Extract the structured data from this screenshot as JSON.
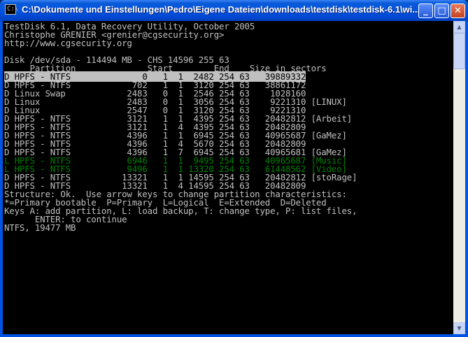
{
  "window": {
    "title": "C:\\Dokumente und Einstellungen\\Pedro\\Eigene Dateien\\downloads\\testdisk\\testdisk-6.1\\wi...",
    "icon": "console-icon",
    "icon_glyph": "C:\\",
    "buttons": {
      "minimize": "_",
      "maximize": "□",
      "close": "✕"
    }
  },
  "console": {
    "header": [
      "TestDisk 6.1, Data Recovery Utility, October 2005",
      "Christophe GRENIER <grenier@cgsecurity.org>",
      "http://www.cgsecurity.org"
    ],
    "disk_line": "Disk /dev/sda - 114494 MB - CHS 14596 255 63",
    "columns_line": "     Partition              Start        End    Size in sectors",
    "partitions": [
      {
        "text": "D HPFS - NTFS              0   1  1  2482 254 63   39889332",
        "selected": true,
        "color": "#c0c0c0"
      },
      {
        "text": "D HPFS - NTFS            702   1  1  3120 254 63   38861172",
        "color": "#c0c0c0"
      },
      {
        "text": "D Linux Swap            2483   0  1  2546 254 63    1028160",
        "color": "#c0c0c0"
      },
      {
        "text": "D Linux                 2483   0  1  3056 254 63    9221310 [LINUX]",
        "color": "#c0c0c0"
      },
      {
        "text": "D Linux                 2547   0  1  3120 254 63    9221310",
        "color": "#c0c0c0"
      },
      {
        "text": "D HPFS - NTFS           3121   1  1  4395 254 63   20482812 [Arbeit]",
        "color": "#c0c0c0"
      },
      {
        "text": "D HPFS - NTFS           3121   1  4  4395 254 63   20482809",
        "color": "#c0c0c0"
      },
      {
        "text": "D HPFS - NTFS           4396   1  1  6945 254 63   40965687 [GaMez]",
        "color": "#c0c0c0"
      },
      {
        "text": "D HPFS - NTFS           4396   1  4  5670 254 63   20482809",
        "color": "#c0c0c0"
      },
      {
        "text": "D HPFS - NTFS           4396   1  7  6945 254 63   40965681 [GaMez]",
        "color": "#c0c0c0"
      },
      {
        "text": "L HPFS - NTFS           6946   1  1  9495 254 63   40965687 [Music]",
        "color": "#008000"
      },
      {
        "text": "L HPFS - NTFS           9496   1  1 13320 254 63   61448562 [Video]",
        "color": "#008000"
      },
      {
        "text": "D HPFS - NTFS          13321   1  1 14595 254 63   20482812 [stoRage]",
        "color": "#c0c0c0"
      },
      {
        "text": "D HPFS - NTFS          13321   1  4 14595 254 63   20482809",
        "color": "#c0c0c0"
      }
    ],
    "footer": [
      "Structure: Ok.  Use arrow keys to change partition characteristics:",
      "*=Primary bootable  P=Primary  L=Logical  E=Extended  D=Deleted",
      "Keys A: add partition, L: load backup, T: change type, P: list files,",
      "      ENTER: to continue",
      "NTFS, 19477 MB"
    ]
  },
  "scrollbar": {
    "up": "▲",
    "down": "▼"
  }
}
